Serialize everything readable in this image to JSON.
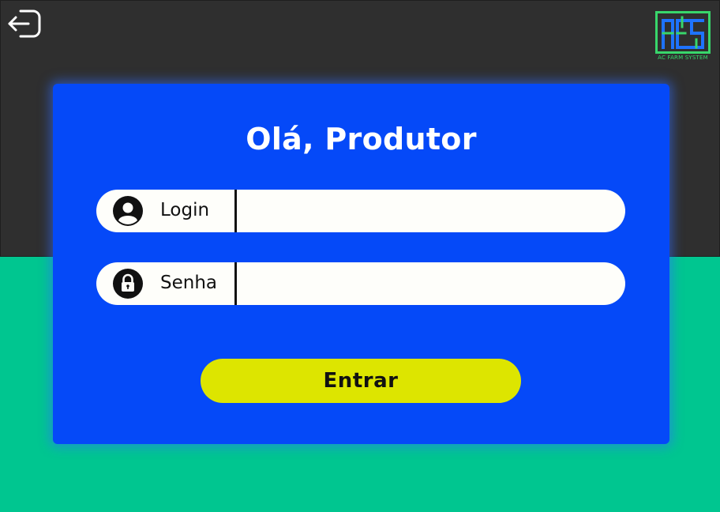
{
  "header": {
    "exit_icon": "exit-arrow-icon",
    "logo": {
      "text": "AC FARM SYSTEM",
      "color": "#38d66b"
    }
  },
  "login_card": {
    "title": "Olá, Produtor",
    "login_field": {
      "label": "Login",
      "icon": "user-icon",
      "value": ""
    },
    "password_field": {
      "label": "Senha",
      "icon": "lock-icon",
      "value": ""
    },
    "submit_label": "Entrar"
  },
  "colors": {
    "top_background": "#2f2f2f",
    "bottom_background": "#00c690",
    "card": "#0549f8",
    "button": "#dde500",
    "input_background": "#fefefa"
  }
}
